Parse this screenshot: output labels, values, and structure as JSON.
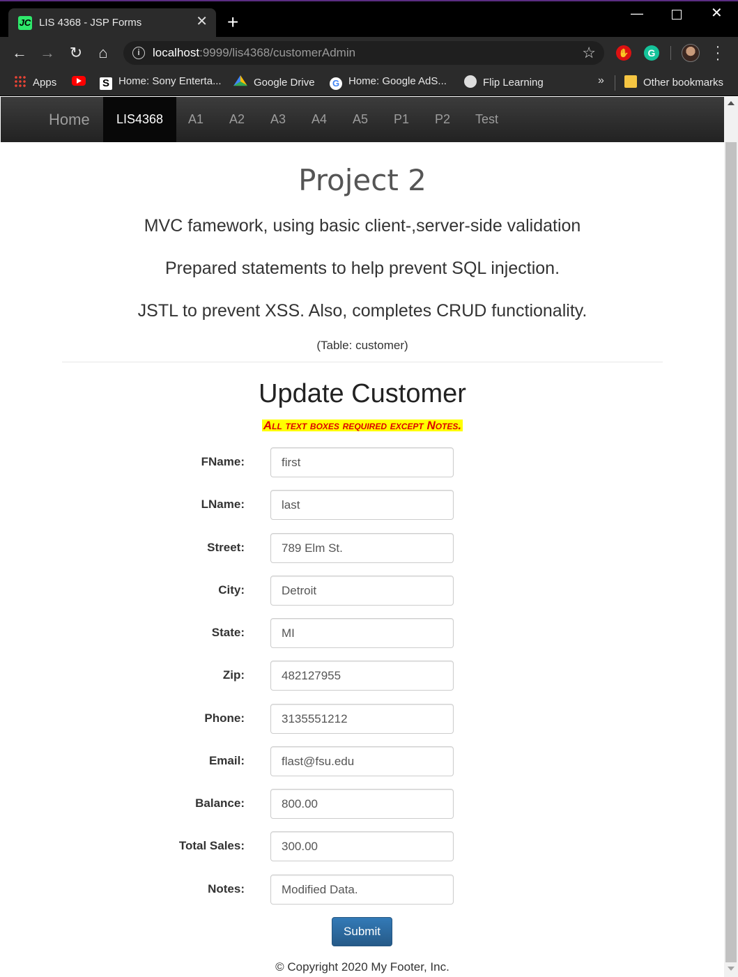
{
  "browser": {
    "tab_title": "LIS 4368 - JSP Forms",
    "tab_favicon_text": "JC",
    "url_host": "localhost",
    "url_path": ":9999/lis4368/customerAdmin",
    "bookmarks": [
      {
        "label": "Apps",
        "icon": "apps-icon"
      },
      {
        "label": "",
        "icon": "youtube-icon"
      },
      {
        "label": "Home: Sony Enterta...",
        "icon": "sony-icon"
      },
      {
        "label": "Google Drive",
        "icon": "google-drive-icon"
      },
      {
        "label": "Home: Google AdS...",
        "icon": "google-icon"
      },
      {
        "label": "Flip Learning",
        "icon": "globe-icon"
      }
    ],
    "other_bookmarks": "Other bookmarks"
  },
  "navbar": {
    "brand": "Home",
    "items": [
      "LIS4368",
      "A1",
      "A2",
      "A3",
      "A4",
      "A5",
      "P1",
      "P2",
      "Test"
    ],
    "active": "LIS4368"
  },
  "header": {
    "title": "Project 2",
    "lines": [
      "MVC famework, using basic client-,server-side validation",
      "Prepared statements to help prevent SQL injection.",
      "JSTL to prevent XSS. Also, completes CRUD functionality."
    ],
    "table_note": "(Table: customer)"
  },
  "form": {
    "title": "Update Customer",
    "required_note": "All text boxes required except Notes.",
    "fields": [
      {
        "label": "FName:",
        "value": "first"
      },
      {
        "label": "LName:",
        "value": "last"
      },
      {
        "label": "Street:",
        "value": "789 Elm St."
      },
      {
        "label": "City:",
        "value": "Detroit"
      },
      {
        "label": "State:",
        "value": "MI"
      },
      {
        "label": "Zip:",
        "value": "482127955"
      },
      {
        "label": "Phone:",
        "value": "3135551212"
      },
      {
        "label": "Email:",
        "value": "flast@fsu.edu"
      },
      {
        "label": "Balance:",
        "value": "800.00"
      },
      {
        "label": "Total Sales:",
        "value": "300.00"
      },
      {
        "label": "Notes:",
        "value": "Modified Data."
      }
    ],
    "submit_label": "Submit"
  },
  "footer": {
    "text": "© Copyright 2020 My Footer, Inc."
  },
  "colors": {
    "required_bg": "#ffff00",
    "required_text": "#dd0000",
    "submit_bg": "#337ab7",
    "navbar_bg": "#222222"
  }
}
